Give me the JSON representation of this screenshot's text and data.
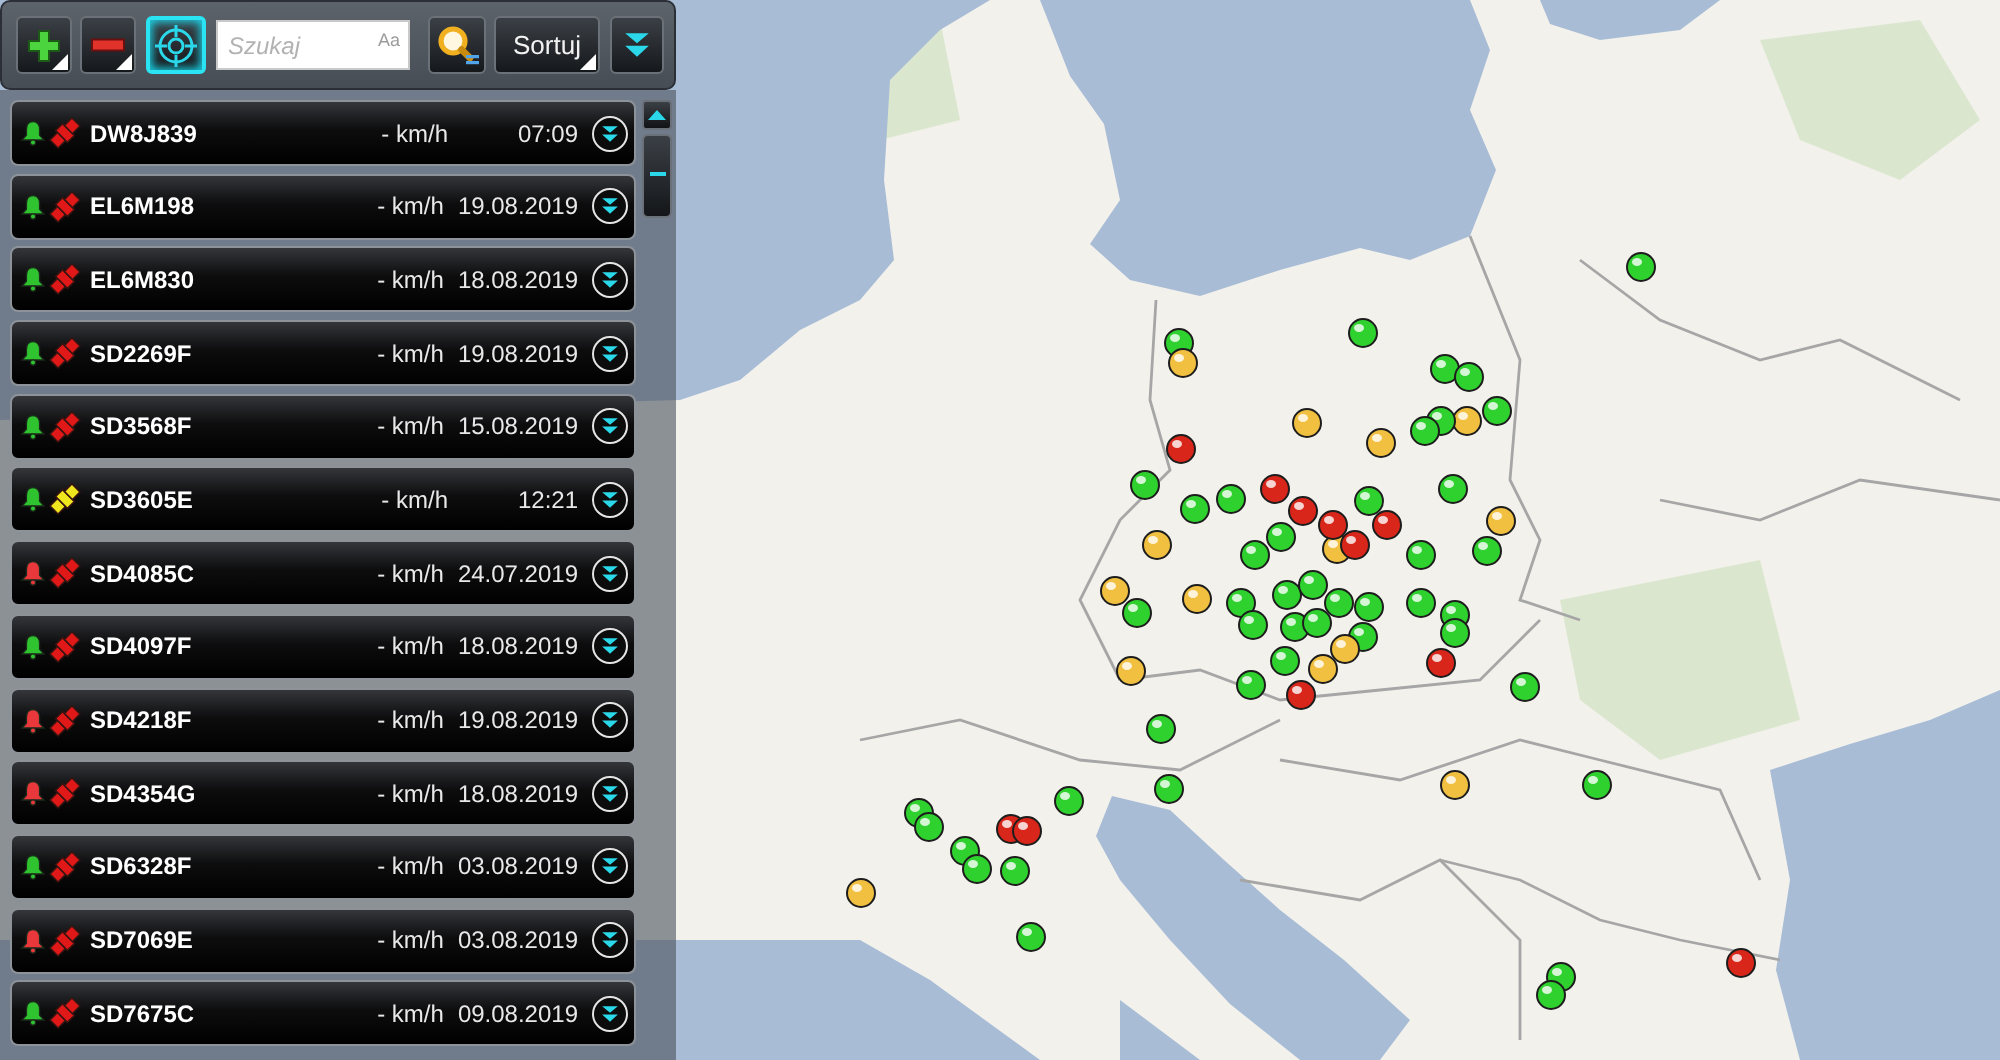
{
  "toolbar": {
    "buttons": [
      {
        "kind": "add",
        "on": false
      },
      {
        "kind": "remove",
        "on": false
      },
      {
        "kind": "locate",
        "on": true
      }
    ],
    "search": {
      "placeholder": "Szukaj",
      "case_toggle": "Aa"
    },
    "sort_button": "Sortuj"
  },
  "vehicles": [
    {
      "plate": "DW8J839",
      "speed": "- km/h",
      "last_seen": "07:09",
      "alarm": {
        "color": "#2fc42f"
      },
      "gps": {
        "color": "#e01818"
      }
    },
    {
      "plate": "EL6M198",
      "speed": "- km/h",
      "last_seen": "19.08.2019",
      "alarm": {
        "color": "#2fc42f"
      },
      "gps": {
        "color": "#e01818"
      }
    },
    {
      "plate": "EL6M830",
      "speed": "- km/h",
      "last_seen": "18.08.2019",
      "alarm": {
        "color": "#2fc42f"
      },
      "gps": {
        "color": "#e01818"
      }
    },
    {
      "plate": "SD2269F",
      "speed": "- km/h",
      "last_seen": "19.08.2019",
      "alarm": {
        "color": "#2fc42f"
      },
      "gps": {
        "color": "#e01818"
      }
    },
    {
      "plate": "SD3568F",
      "speed": "- km/h",
      "last_seen": "15.08.2019",
      "alarm": {
        "color": "#2fc42f"
      },
      "gps": {
        "color": "#e01818"
      }
    },
    {
      "plate": "SD3605E",
      "speed": "- km/h",
      "last_seen": "12:21",
      "alarm": {
        "color": "#2fc42f"
      },
      "gps": {
        "color": "#f0e61e"
      }
    },
    {
      "plate": "SD4085C",
      "speed": "- km/h",
      "last_seen": "24.07.2019",
      "alarm": {
        "color": "#e8383c"
      },
      "gps": {
        "color": "#e01818"
      }
    },
    {
      "plate": "SD4097F",
      "speed": "- km/h",
      "last_seen": "18.08.2019",
      "alarm": {
        "color": "#2fc42f"
      },
      "gps": {
        "color": "#e01818"
      }
    },
    {
      "plate": "SD4218F",
      "speed": "- km/h",
      "last_seen": "19.08.2019",
      "alarm": {
        "color": "#e8383c"
      },
      "gps": {
        "color": "#e01818"
      }
    },
    {
      "plate": "SD4354G",
      "speed": "- km/h",
      "last_seen": "18.08.2019",
      "alarm": {
        "color": "#e8383c"
      },
      "gps": {
        "color": "#e01818"
      }
    },
    {
      "plate": "SD6328F",
      "speed": "- km/h",
      "last_seen": "03.08.2019",
      "alarm": {
        "color": "#2fc42f"
      },
      "gps": {
        "color": "#e01818"
      }
    },
    {
      "plate": "SD7069E",
      "speed": "- km/h",
      "last_seen": "03.08.2019",
      "alarm": {
        "color": "#e8383c"
      },
      "gps": {
        "color": "#e01818"
      }
    },
    {
      "plate": "SD7675C",
      "speed": "- km/h",
      "last_seen": "09.08.2019",
      "alarm": {
        "color": "#2fc42f"
      },
      "gps": {
        "color": "#e01818"
      }
    }
  ],
  "map": {
    "markers": [
      {
        "color": "#2fd12f"
      },
      {
        "color": "#2fd12f"
      },
      {
        "color": "#2fd12f"
      },
      {
        "color": "#f2c040"
      },
      {
        "color": "#2fd12f"
      },
      {
        "color": "#2fd12f"
      },
      {
        "color": "#f2c040"
      },
      {
        "color": "#2fd12f"
      },
      {
        "color": "#f2c040"
      },
      {
        "color": "#2fd12f"
      },
      {
        "color": "#2fd12f"
      },
      {
        "color": "#f2c040"
      },
      {
        "color": "#d8261a"
      },
      {
        "color": "#2fd12f"
      },
      {
        "color": "#2fd12f"
      },
      {
        "color": "#2fd12f"
      },
      {
        "color": "#d8261a"
      },
      {
        "color": "#d8261a"
      },
      {
        "color": "#2fd12f"
      },
      {
        "color": "#2fd12f"
      },
      {
        "color": "#f2c040"
      },
      {
        "color": "#f2c040"
      },
      {
        "color": "#f2c040"
      },
      {
        "color": "#2fd12f"
      },
      {
        "color": "#f2c040"
      },
      {
        "color": "#2fd12f"
      },
      {
        "color": "#2fd12f"
      },
      {
        "color": "#2fd12f"
      },
      {
        "color": "#2fd12f"
      },
      {
        "color": "#2fd12f"
      },
      {
        "color": "#2fd12f"
      },
      {
        "color": "#2fd12f"
      },
      {
        "color": "#2fd12f"
      },
      {
        "color": "#2fd12f"
      },
      {
        "color": "#2fd12f"
      },
      {
        "color": "#f2c040"
      },
      {
        "color": "#f2c040"
      },
      {
        "color": "#2fd12f"
      },
      {
        "color": "#2fd12f"
      },
      {
        "color": "#d8261a"
      },
      {
        "color": "#f2c040"
      },
      {
        "color": "#d8261a"
      },
      {
        "color": "#2fd12f"
      },
      {
        "color": "#2fd12f"
      },
      {
        "color": "#2fd12f"
      },
      {
        "color": "#2fd12f"
      },
      {
        "color": "#2fd12f"
      },
      {
        "color": "#d8261a"
      },
      {
        "color": "#2fd12f"
      },
      {
        "color": "#f2c040"
      },
      {
        "color": "#2fd12f"
      },
      {
        "color": "#2fd12f"
      },
      {
        "color": "#2fd12f"
      },
      {
        "color": "#f2c040"
      },
      {
        "color": "#2fd12f"
      },
      {
        "color": "#2fd12f"
      },
      {
        "color": "#2fd12f"
      },
      {
        "color": "#2fd12f"
      },
      {
        "color": "#2fd12f"
      },
      {
        "color": "#d8261a"
      },
      {
        "color": "#d8261a"
      },
      {
        "color": "#2fd12f"
      },
      {
        "color": "#f2c040"
      },
      {
        "color": "#2fd12f"
      },
      {
        "color": "#2fd12f"
      },
      {
        "color": "#2fd12f"
      },
      {
        "color": "#d8261a"
      },
      {
        "color": "#d8261a"
      },
      {
        "color": "#d8261a"
      },
      {
        "color": "#2fd12f"
      }
    ]
  }
}
